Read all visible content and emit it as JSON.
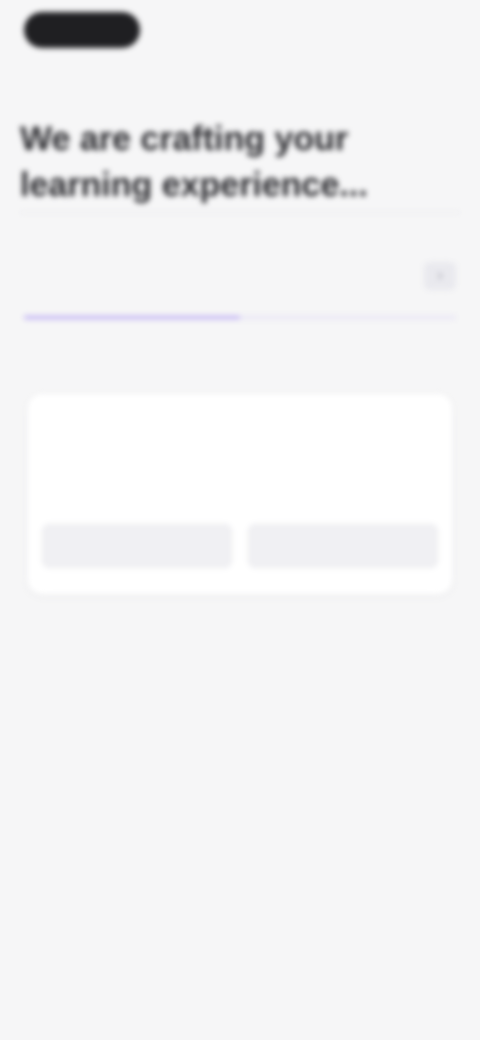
{
  "topbar": {
    "logo_label": "",
    "right_link_label": ""
  },
  "hero": {
    "title": "We are crafting your learning experience..."
  },
  "status": {
    "message": "",
    "link_label": "",
    "progress": 0.5
  },
  "feedback": {
    "kicker": "",
    "question": "",
    "yes_label": "",
    "no_label": ""
  },
  "icons": {
    "status_icon": "chevron-right-icon"
  },
  "colors": {
    "accent": "#7b5cf0",
    "background": "#f6f6f7",
    "logo_bg": "#1f1f22"
  }
}
